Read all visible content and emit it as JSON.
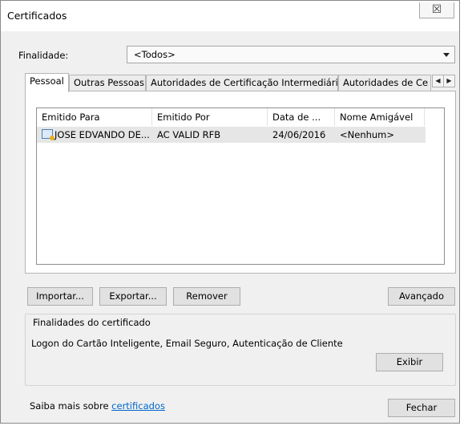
{
  "window": {
    "title": "Certificados",
    "close_glyph": "☒"
  },
  "finalidade": {
    "label": "Finalidade:",
    "selected": "<Todos>"
  },
  "tabs": [
    {
      "label": "Pessoal",
      "active": true
    },
    {
      "label": "Outras Pessoas",
      "active": false
    },
    {
      "label": "Autoridades de Certificação Intermediárias",
      "active": false
    },
    {
      "label": "Autoridades de Ce",
      "active": false
    }
  ],
  "tab_scroll": {
    "left": "◀",
    "right": "▶"
  },
  "table": {
    "columns": [
      "Emitido Para",
      "Emitido Por",
      "Data de ...",
      "Nome Amigável"
    ],
    "rows": [
      {
        "issued_to": "JOSE EDVANDO DE...",
        "issued_by": "AC VALID RFB",
        "date": "24/06/2016",
        "friendly_name": "<Nenhum>"
      }
    ]
  },
  "buttons": {
    "import": "Importar...",
    "export": "Exportar...",
    "remove": "Remover",
    "advanced": "Avançado",
    "view": "Exibir",
    "close": "Fechar"
  },
  "purposes": {
    "legend": "Finalidades do certificado",
    "text": "Logon do Cartão Inteligente, Email Seguro, Autenticação de Cliente"
  },
  "footer": {
    "prefix": "Saiba mais sobre ",
    "link": "certificados"
  },
  "icons": {
    "certificate": "certificate-icon",
    "dropdown": "chevron-down-icon"
  },
  "colors": {
    "link": "#0066cc",
    "selection": "#e6e6e6",
    "dialog_bg": "#f0f0f0"
  }
}
